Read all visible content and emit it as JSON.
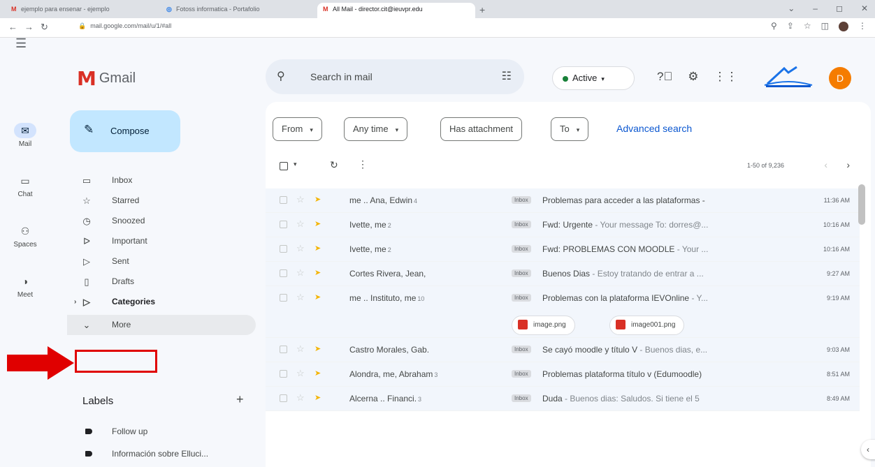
{
  "browser": {
    "tabs": [
      {
        "title": "ejemplo para ensenar - ejemplo"
      },
      {
        "title": "Fotoss informatica - Portafolio"
      },
      {
        "title": "All Mail - director.cit@ieuvpr.edu"
      }
    ],
    "url": "mail.google.com/mail/u/1/#all"
  },
  "rail": {
    "items": [
      {
        "label": "Mail"
      },
      {
        "label": "Chat"
      },
      {
        "label": "Spaces"
      },
      {
        "label": "Meet"
      }
    ]
  },
  "logo": {
    "text": "Gmail"
  },
  "compose": {
    "label": "Compose"
  },
  "nav": {
    "items": [
      {
        "label": "Inbox"
      },
      {
        "label": "Starred"
      },
      {
        "label": "Snoozed"
      },
      {
        "label": "Important"
      },
      {
        "label": "Sent"
      },
      {
        "label": "Drafts"
      },
      {
        "label": "Categories"
      },
      {
        "label": "More"
      }
    ]
  },
  "labels": {
    "heading": "Labels",
    "items": [
      {
        "label": "Follow up"
      },
      {
        "label": "Información sobre Elluci..."
      }
    ]
  },
  "search": {
    "placeholder": "Search in mail"
  },
  "status": {
    "label": "Active"
  },
  "avatar": {
    "initial": "D"
  },
  "filters": {
    "from": "From",
    "any_time": "Any time",
    "has_attachment": "Has attachment",
    "to": "To",
    "advanced": "Advanced search"
  },
  "toolbar": {
    "pager": "1-50 of 9,236"
  },
  "emails": [
    {
      "sender": "me .. Ana, Edwin",
      "count": "4",
      "badge": "Inbox",
      "subject": "Problemas para acceder a las plataformas -",
      "snippet": "",
      "time": "11:36 AM"
    },
    {
      "sender": "Ivette, me",
      "count": "2",
      "badge": "Inbox",
      "subject": "Fwd: Urgente",
      "snippet": " - Your message To: dorres@...",
      "time": "10:16 AM"
    },
    {
      "sender": "Ivette, me",
      "count": "2",
      "badge": "Inbox",
      "subject": "Fwd: PROBLEMAS CON MOODLE",
      "snippet": " - Your ...",
      "time": "10:16 AM"
    },
    {
      "sender": "Cortes Rivera, Jean,",
      "count": "",
      "badge": "Inbox",
      "subject": "Buenos Dias",
      "snippet": " - Estoy tratando de entrar a ...",
      "time": "9:27 AM"
    },
    {
      "sender": "me .. Instituto, me",
      "count": "10",
      "badge": "Inbox",
      "subject": "Problemas con la plataforma IEVOnline",
      "snippet": " - Y...",
      "time": "9:19 AM",
      "attachments": [
        "image.png",
        "image001.png"
      ]
    },
    {
      "sender": "Castro Morales, Gab.",
      "count": "",
      "badge": "Inbox",
      "subject": "Se cayó moodle y título V",
      "snippet": " - Buenos dias, e...",
      "time": "9:03 AM"
    },
    {
      "sender": "Alondra, me, Abraham",
      "count": "3",
      "badge": "Inbox",
      "subject": "Problemas plataforma título v (Edumoodle)",
      "snippet": "",
      "time": "8:51 AM"
    },
    {
      "sender": "Alcerna .. Financi.",
      "count": "3",
      "badge": "Inbox",
      "subject": "Duda",
      "snippet": " - Buenos dias: Saludos. Si tiene el 5",
      "time": "8:49 AM"
    }
  ],
  "colors": {
    "accent": "#0b57d0",
    "compose_bg": "#c2e7ff",
    "highlight": "#e00000",
    "background": "#f6f8fc"
  }
}
